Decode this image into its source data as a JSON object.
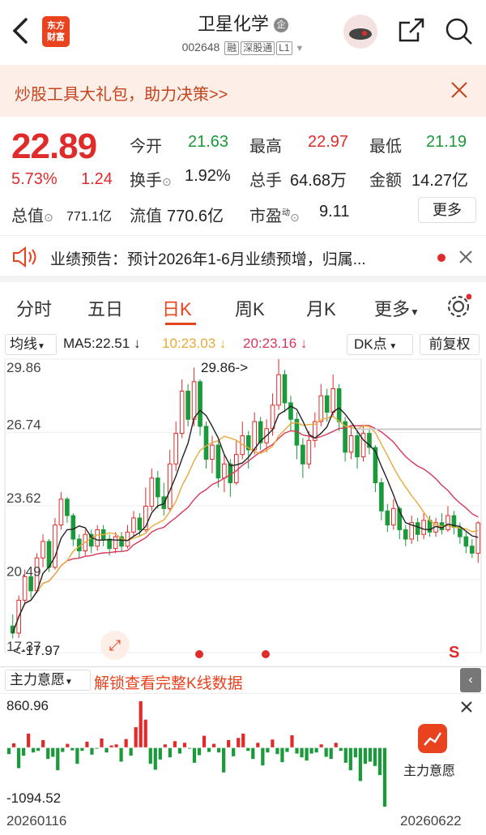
{
  "header": {
    "logo_line1": "东方",
    "logo_line2": "财富",
    "stock_name": "卫星化学",
    "badge": "企",
    "code": "002648",
    "tags": [
      "融",
      "深股通",
      "L1"
    ]
  },
  "banner": {
    "text": "炒股工具大礼包，助力决策>>"
  },
  "quote": {
    "price": "22.89",
    "change_pct": "5.73%",
    "change_amt": "1.24",
    "open_label": "今开",
    "open": "21.63",
    "high_label": "最高",
    "high": "22.97",
    "low_label": "最低",
    "low": "21.19",
    "turnover_label": "换手",
    "turnover": "1.92%",
    "volume_label": "总手",
    "volume": "64.68万",
    "amount_label": "金额",
    "amount": "14.27亿",
    "mktcap_label": "总值",
    "mktcap": "771.1亿",
    "float_label": "流值",
    "float": "770.6亿",
    "pe_label": "市盈",
    "pe_sup": "动",
    "pe": "9.11",
    "more_button": "更多"
  },
  "notice": {
    "text": "业绩预告：预计2026年1-6月业绩预增，归属..."
  },
  "tabs": [
    "分时",
    "五日",
    "日K",
    "周K",
    "月K",
    "更多"
  ],
  "active_tab": "日K",
  "indicator_bar": {
    "ma_label": "均线",
    "ma5": "MA5:22.51 ↓",
    "ma10": "10:23.03 ↓",
    "ma20": "20:23.16 ↓",
    "dk_button": "DK点",
    "adjust_button": "前复权"
  },
  "colors": {
    "up": "#e02b2b",
    "down": "#1a9a3a",
    "ma5": "#222222",
    "ma10": "#e8a93a",
    "ma20": "#d8365a"
  },
  "chart_data": {
    "type": "candlestick",
    "yaxis_ticks": [
      "29.86",
      "26.74",
      "23.62",
      "20.49",
      "17.37"
    ],
    "ylim": [
      17.37,
      29.86
    ],
    "annotations": {
      "max": "29.86->",
      "min": "<-17.97"
    },
    "start_date": "20260116",
    "end_date": "20260622",
    "series": [
      {
        "name": "MA5"
      },
      {
        "name": "10"
      },
      {
        "name": "20"
      }
    ],
    "candles": [
      [
        18.5,
        18.2,
        19.0,
        17.97
      ],
      [
        18.2,
        19.6,
        19.8,
        18.0
      ],
      [
        19.6,
        20.6,
        20.9,
        19.4
      ],
      [
        20.6,
        20.0,
        20.8,
        19.7
      ],
      [
        20.0,
        21.4,
        21.6,
        19.9
      ],
      [
        21.4,
        22.1,
        22.4,
        21.0
      ],
      [
        22.1,
        21.0,
        22.2,
        20.8
      ],
      [
        21.0,
        22.8,
        23.1,
        20.9
      ],
      [
        22.8,
        23.9,
        24.2,
        22.6
      ],
      [
        23.9,
        23.2,
        24.0,
        22.9
      ],
      [
        23.2,
        22.2,
        23.3,
        21.9
      ],
      [
        22.2,
        21.7,
        22.4,
        21.4
      ],
      [
        21.7,
        22.4,
        22.6,
        21.5
      ],
      [
        22.4,
        21.9,
        22.6,
        21.6
      ],
      [
        21.9,
        22.6,
        22.8,
        21.7
      ],
      [
        22.6,
        22.2,
        22.8,
        21.9
      ],
      [
        22.2,
        21.8,
        22.4,
        21.5
      ],
      [
        21.8,
        22.3,
        22.5,
        21.6
      ],
      [
        22.3,
        21.9,
        22.5,
        21.7
      ],
      [
        21.9,
        22.5,
        22.8,
        21.8
      ],
      [
        22.5,
        23.1,
        23.4,
        22.3
      ],
      [
        23.1,
        22.6,
        23.3,
        22.3
      ],
      [
        22.6,
        23.6,
        24.4,
        22.5
      ],
      [
        23.6,
        24.8,
        25.2,
        23.4
      ],
      [
        24.8,
        24.0,
        25.1,
        23.5
      ],
      [
        24.0,
        23.5,
        24.6,
        23.2
      ],
      [
        23.5,
        25.4,
        26.0,
        23.4
      ],
      [
        25.4,
        26.7,
        27.2,
        25.1
      ],
      [
        26.7,
        28.5,
        29.0,
        26.5
      ],
      [
        28.5,
        27.3,
        28.8,
        27.0
      ],
      [
        27.3,
        28.9,
        29.5,
        27.0
      ],
      [
        28.9,
        27.0,
        29.0,
        26.6
      ],
      [
        27.0,
        25.6,
        27.2,
        25.2
      ],
      [
        25.6,
        26.2,
        26.6,
        25.0
      ],
      [
        26.2,
        24.8,
        26.4,
        24.4
      ],
      [
        24.8,
        25.4,
        25.8,
        24.2
      ],
      [
        25.4,
        24.6,
        25.6,
        24.0
      ],
      [
        24.6,
        25.8,
        26.4,
        24.5
      ],
      [
        25.8,
        26.6,
        27.2,
        25.6
      ],
      [
        26.6,
        26.0,
        26.8,
        25.2
      ],
      [
        26.0,
        27.2,
        27.6,
        25.8
      ],
      [
        27.2,
        26.3,
        27.4,
        26.0
      ],
      [
        26.3,
        26.9,
        27.3,
        25.9
      ],
      [
        26.9,
        27.9,
        28.4,
        26.6
      ],
      [
        27.9,
        29.2,
        29.86,
        27.7
      ],
      [
        29.2,
        28.0,
        29.4,
        27.6
      ],
      [
        28.0,
        27.3,
        28.3,
        26.8
      ],
      [
        27.3,
        26.2,
        27.6,
        25.6
      ],
      [
        26.2,
        25.4,
        26.5,
        24.8
      ],
      [
        25.4,
        26.4,
        26.8,
        25.2
      ],
      [
        26.4,
        27.2,
        27.6,
        26.1
      ],
      [
        27.2,
        28.3,
        28.8,
        27.0
      ],
      [
        28.3,
        27.6,
        28.6,
        27.2
      ],
      [
        27.6,
        28.6,
        29.2,
        27.4
      ],
      [
        28.6,
        27.2,
        28.8,
        26.8
      ],
      [
        27.2,
        25.9,
        27.4,
        25.5
      ],
      [
        25.9,
        26.6,
        27.0,
        25.6
      ],
      [
        26.6,
        25.7,
        26.8,
        25.2
      ],
      [
        25.7,
        26.7,
        27.0,
        25.5
      ],
      [
        26.7,
        26.1,
        26.9,
        25.8
      ],
      [
        26.1,
        24.6,
        26.2,
        24.2
      ],
      [
        24.6,
        23.4,
        24.8,
        23.0
      ],
      [
        23.4,
        22.8,
        23.7,
        22.5
      ],
      [
        22.8,
        23.5,
        23.9,
        22.6
      ],
      [
        23.5,
        22.6,
        23.6,
        22.2
      ],
      [
        22.6,
        22.2,
        22.8,
        21.9
      ],
      [
        22.2,
        22.9,
        23.2,
        22.0
      ],
      [
        22.9,
        22.4,
        23.1,
        22.1
      ],
      [
        22.4,
        23.0,
        23.3,
        22.2
      ],
      [
        23.0,
        22.5,
        23.2,
        22.3
      ],
      [
        22.5,
        22.9,
        23.1,
        22.3
      ],
      [
        22.9,
        22.6,
        23.3,
        22.4
      ],
      [
        22.6,
        23.2,
        23.6,
        22.5
      ],
      [
        23.2,
        22.7,
        23.4,
        22.4
      ],
      [
        22.7,
        22.3,
        22.9,
        22.0
      ],
      [
        22.3,
        21.9,
        22.5,
        21.6
      ],
      [
        21.9,
        21.6,
        22.2,
        21.4
      ],
      [
        21.6,
        22.89,
        22.97,
        21.19
      ]
    ],
    "flow_ylim": [
      -1094.52,
      860.96
    ],
    "flow_labels": {
      "max": "860.96",
      "min": "-1094.52"
    },
    "flow": [
      -120,
      80,
      -380,
      -150,
      260,
      -90,
      -60,
      140,
      -210,
      -170,
      -420,
      -80,
      70,
      -50,
      -300,
      -60,
      110,
      -130,
      -20,
      170,
      -90,
      40,
      60,
      -260,
      160,
      -150,
      380,
      860.96,
      520,
      -300,
      -410,
      -220,
      60,
      -180,
      120,
      -110,
      90,
      -20,
      -280,
      -140,
      220,
      -80,
      70,
      -90,
      -460,
      140,
      -160,
      180,
      260,
      -60,
      -210,
      90,
      -330,
      -90,
      150,
      -120,
      -270,
      -80,
      230,
      -110,
      -180,
      -240,
      -110,
      -90,
      60,
      -170,
      -210,
      90,
      -60,
      -280,
      -420,
      -180,
      -620,
      -300,
      -260,
      -340,
      -510,
      -1094.52
    ]
  },
  "flow_panel": {
    "title": "主力意愿",
    "unlock_text": "解锁查看完整K线数据",
    "side_label": "主力意愿"
  }
}
